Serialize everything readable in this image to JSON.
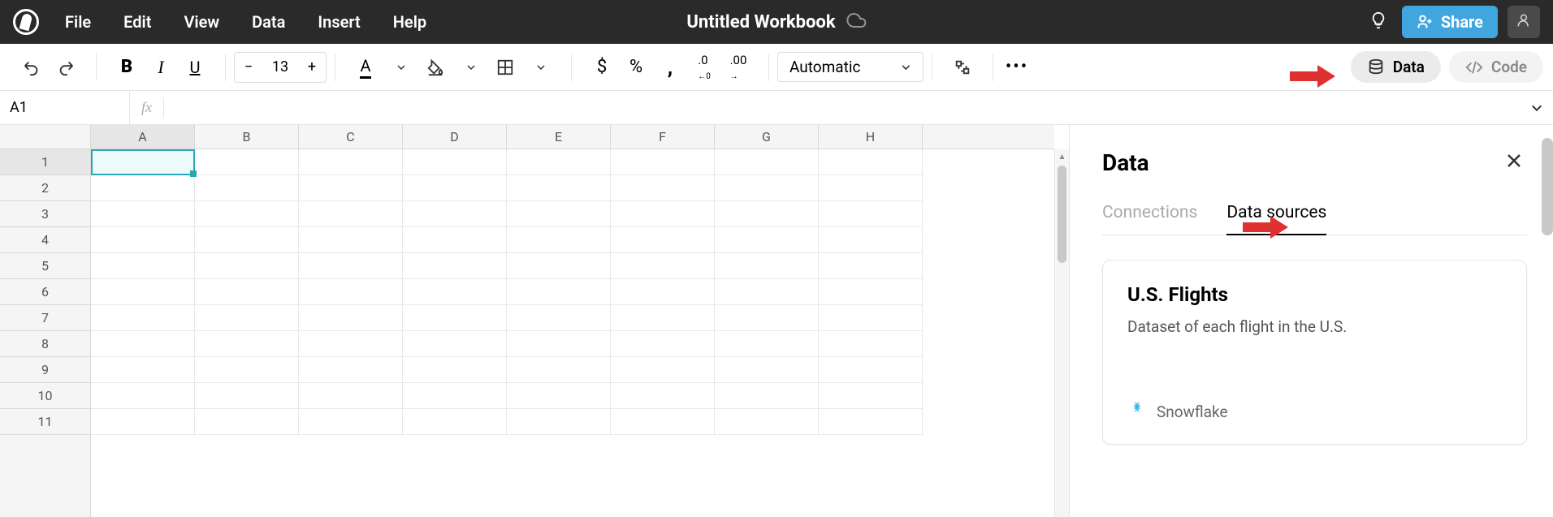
{
  "menubar": {
    "items": [
      "File",
      "Edit",
      "View",
      "Data",
      "Insert",
      "Help"
    ],
    "title": "Untitled Workbook",
    "share_label": "Share"
  },
  "toolbar": {
    "font_size": "13",
    "number_format": "Automatic",
    "data_label": "Data",
    "code_label": "Code"
  },
  "formula_bar": {
    "cell_ref": "A1",
    "fx": "fx",
    "value": ""
  },
  "sheet": {
    "columns": [
      "A",
      "B",
      "C",
      "D",
      "E",
      "F",
      "G",
      "H"
    ],
    "rows": [
      "1",
      "2",
      "3",
      "4",
      "5",
      "6",
      "7",
      "8",
      "9",
      "10",
      "11"
    ],
    "selected": "A1"
  },
  "panel": {
    "title": "Data",
    "tabs": {
      "connections": "Connections",
      "data_sources": "Data sources"
    },
    "active_tab": "data_sources",
    "card": {
      "title": "U.S. Flights",
      "description": "Dataset of each flight in the U.S.",
      "provider": "Snowflake"
    }
  }
}
